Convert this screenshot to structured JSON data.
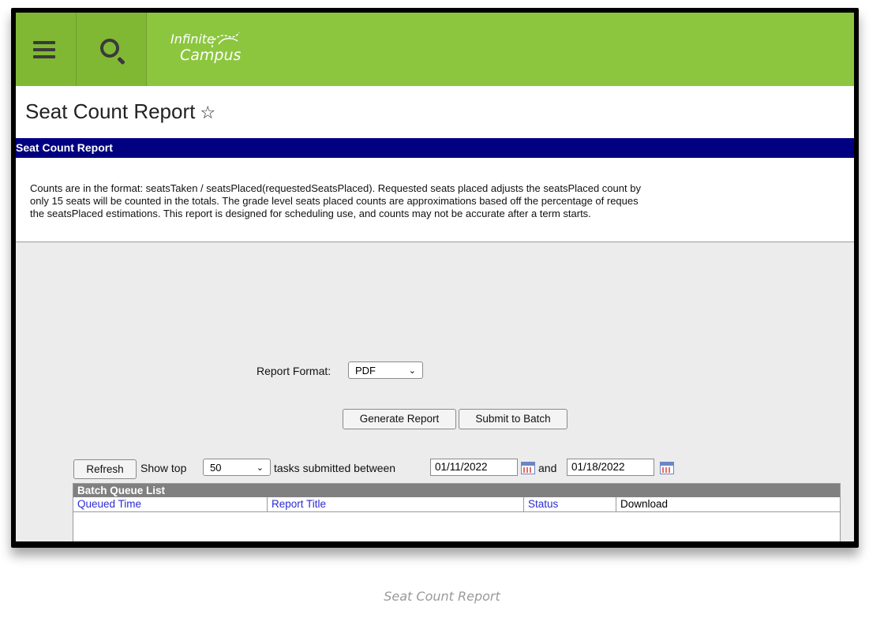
{
  "app": {
    "logo_line1": "Infinite",
    "logo_line2": "Campus"
  },
  "header": {
    "page_title": "Seat Count Report",
    "star_glyph": "☆",
    "menu_icon": "hamburger-icon",
    "search_icon": "search-icon"
  },
  "section": {
    "title": "Seat Count Report",
    "description_lines": [
      "Counts are in the format: seatsTaken / seatsPlaced(requestedSeatsPlaced). Requested seats placed adjusts the seatsPlaced count by",
      "only 15 seats will be counted in the totals. The grade level seats placed counts are approximations based off the percentage of reques",
      "the seatsPlaced estimations. This report is designed for scheduling use, and counts may not be accurate after a term starts."
    ]
  },
  "form": {
    "report_format_label": "Report Format:",
    "report_format_value": "PDF",
    "generate_label": "Generate Report",
    "submit_batch_label": "Submit to Batch"
  },
  "batch_controls": {
    "refresh_label": "Refresh",
    "show_top_label": "Show top",
    "show_top_value": "50",
    "tasks_between_label": "tasks submitted between",
    "start_date": "01/11/2022",
    "and_label": "and",
    "end_date": "01/18/2022"
  },
  "batch_queue": {
    "title": "Batch Queue List",
    "columns": [
      "Queued Time",
      "Report Title",
      "Status",
      "Download"
    ]
  },
  "caption": "Seat Count Report",
  "colors": {
    "topbar": "#8cc63f",
    "section_header": "#000080",
    "link": "#2b2bd6"
  }
}
